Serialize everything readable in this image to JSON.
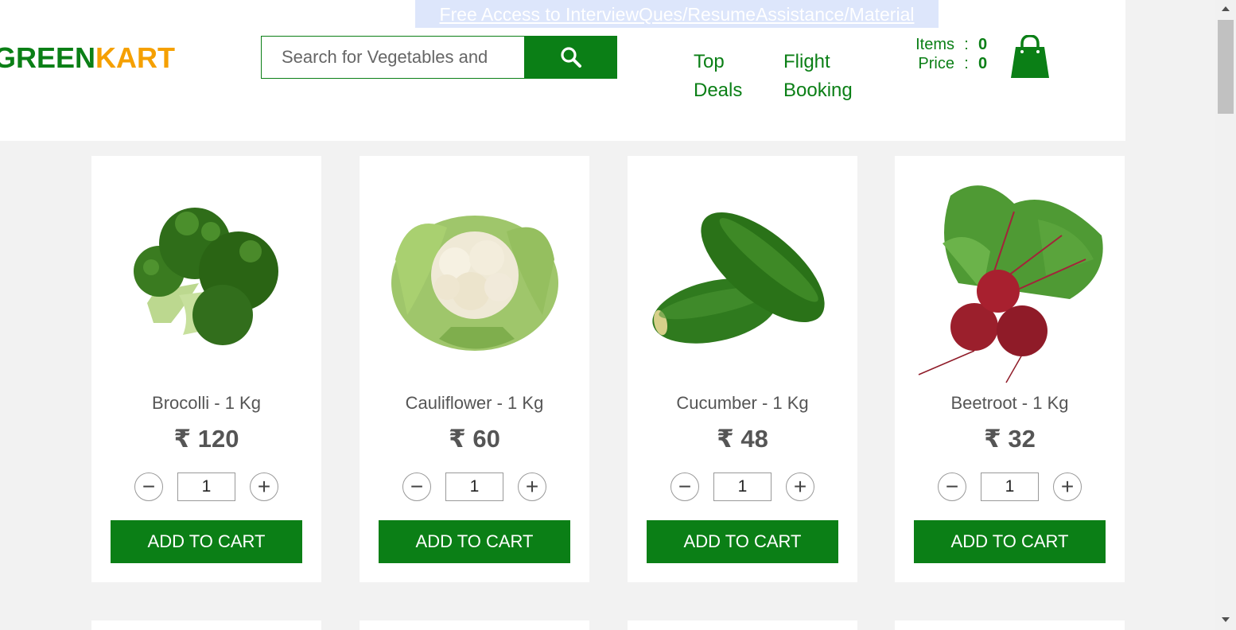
{
  "promo": {
    "text": "Free Access to InterviewQues/ResumeAssistance/Material"
  },
  "logo": {
    "part1": "GREEN",
    "part2": "KART"
  },
  "search": {
    "placeholder": "Search for Vegetables and Fruits",
    "value": ""
  },
  "nav": [
    {
      "label": "Top Deals"
    },
    {
      "label": "Flight Booking"
    }
  ],
  "cart": {
    "items_label": "Items",
    "items_value": "0",
    "price_label": "Price",
    "price_value": "0",
    "colon": ":"
  },
  "products": [
    {
      "name": "Brocolli - 1 Kg",
      "price": "₹ 120",
      "qty": "1",
      "button": "ADD TO CART",
      "image": "broccoli"
    },
    {
      "name": "Cauliflower - 1 Kg",
      "price": "₹ 60",
      "qty": "1",
      "button": "ADD TO CART",
      "image": "cauliflower"
    },
    {
      "name": "Cucumber - 1 Kg",
      "price": "₹ 48",
      "qty": "1",
      "button": "ADD TO CART",
      "image": "cucumber"
    },
    {
      "name": "Beetroot - 1 Kg",
      "price": "₹ 32",
      "qty": "1",
      "button": "ADD TO CART",
      "image": "beetroot"
    }
  ],
  "stepper": {
    "minus": "−",
    "plus": "+"
  },
  "colors": {
    "brand_green": "#0b7f16",
    "brand_orange": "#f5a000"
  }
}
